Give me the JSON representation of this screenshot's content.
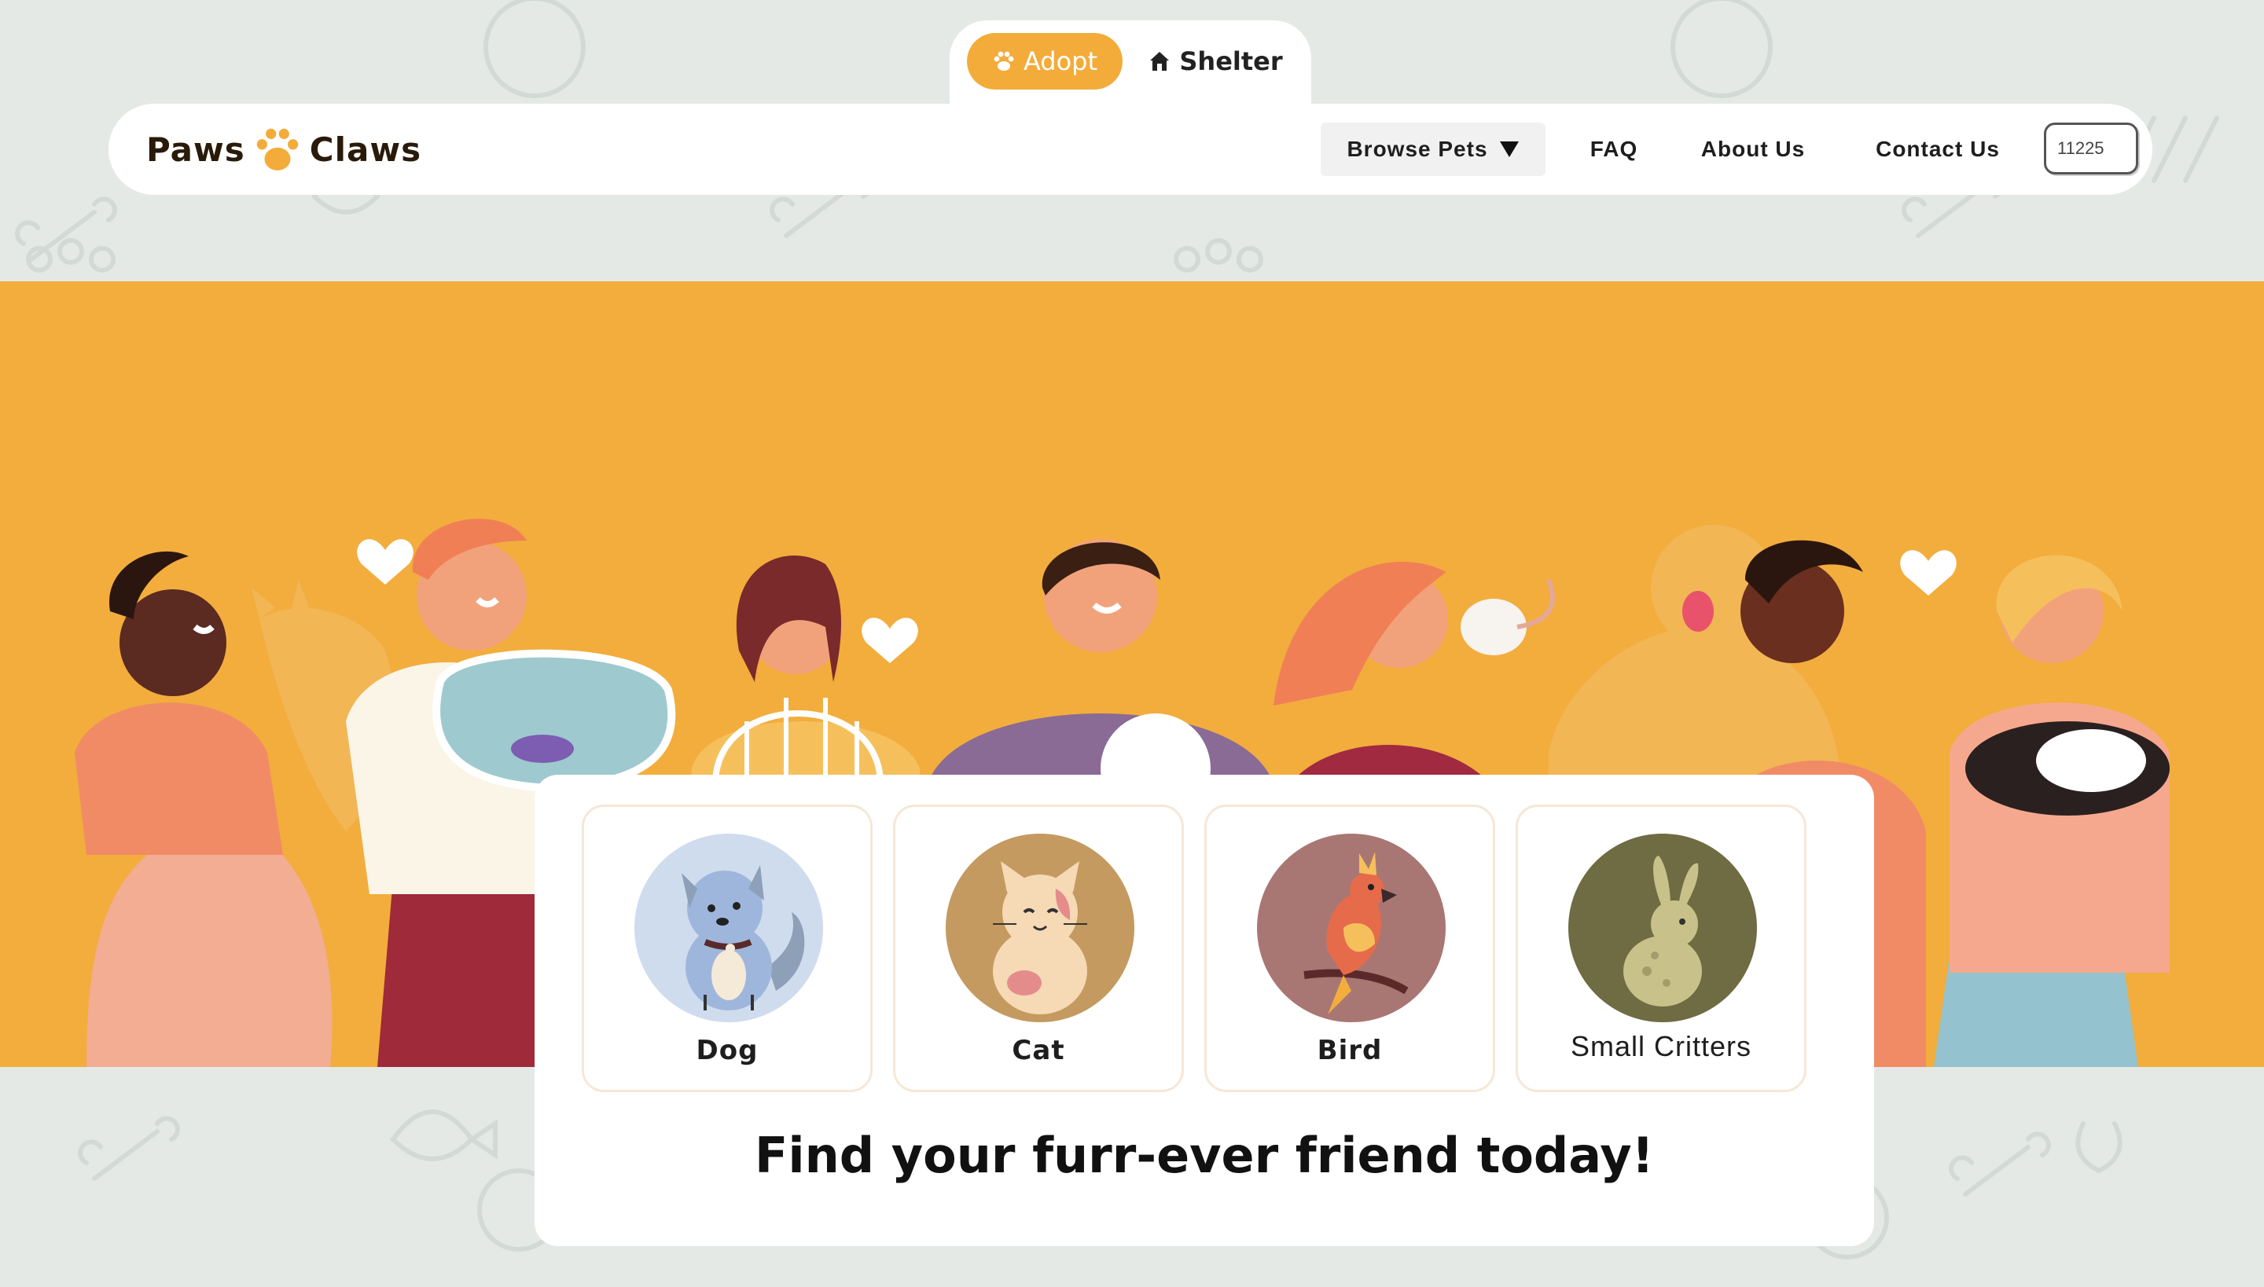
{
  "mode_toggle": {
    "adopt_label": "Adopt",
    "shelter_label": "Shelter",
    "adopt_icon": "paw-icon",
    "shelter_icon": "house-icon"
  },
  "brand": {
    "logo_left": "Paws",
    "logo_right": "Claws",
    "logo_icon": "paw-icon",
    "accent_color": "#f3ac3a"
  },
  "nav": {
    "browse_label": "Browse Pets",
    "browse_icon": "caret-down-icon",
    "faq_label": "FAQ",
    "about_label": "About Us",
    "contact_label": "Contact Us",
    "zip_value": "11225"
  },
  "categories": [
    {
      "label": "Dog",
      "icon": "dog-icon",
      "circle_color": "#cfdcee"
    },
    {
      "label": "Cat",
      "icon": "cat-icon",
      "circle_color": "#c49a60"
    },
    {
      "label": "Bird",
      "icon": "bird-icon",
      "circle_color": "#a97773"
    },
    {
      "label": "Small Critters",
      "icon": "rabbit-icon",
      "circle_color": "#6f6b42"
    }
  ],
  "tagline": "Find your furr-ever friend today!",
  "hero": {
    "background_color": "#f2ad3d",
    "illustration": "people-with-pets-illustration"
  }
}
